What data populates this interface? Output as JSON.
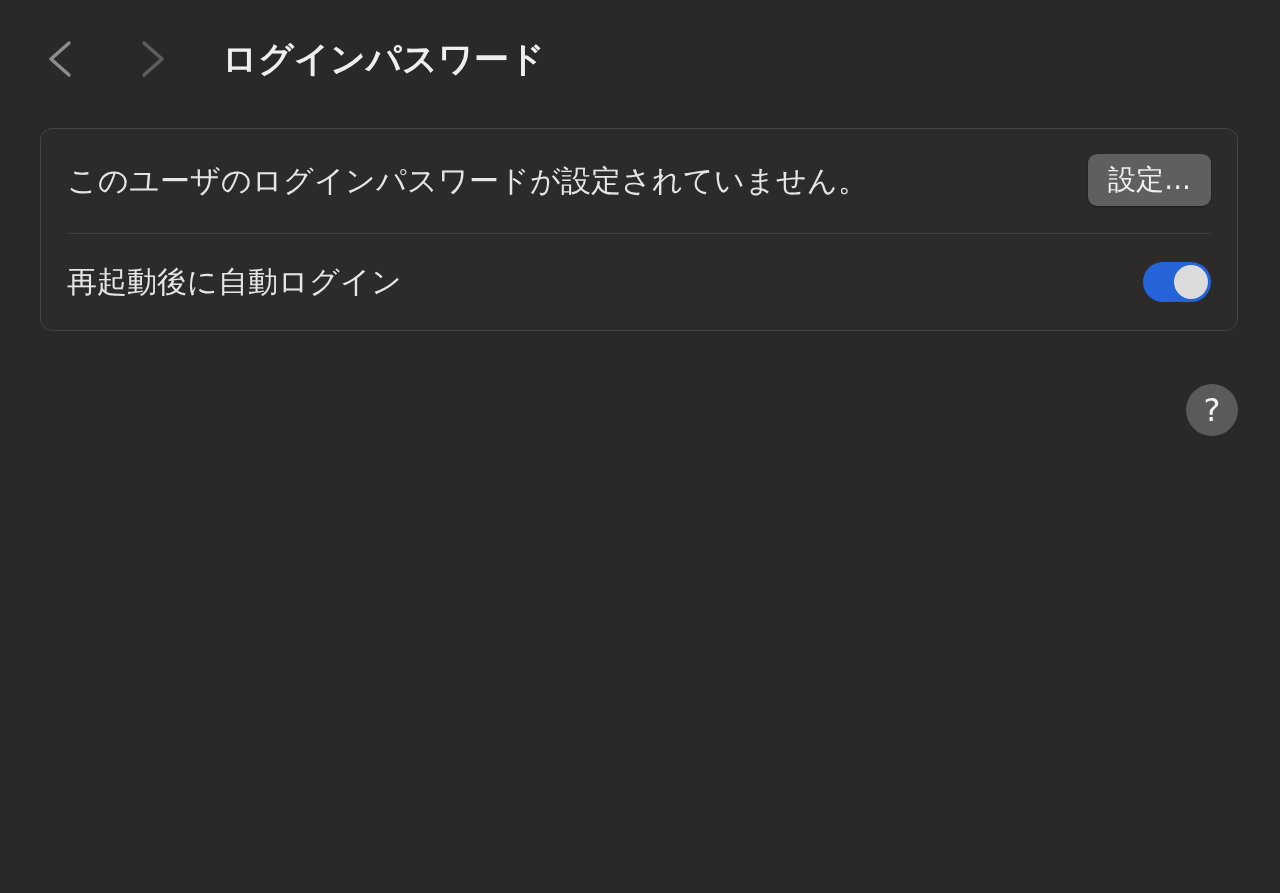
{
  "navigation": {
    "back": {
      "disabled": false
    },
    "forward": {
      "disabled": true
    }
  },
  "title": "ログインパスワード",
  "settings": [
    {
      "kind": "button",
      "label": "このユーザのログインパスワードが設定されていません。",
      "button": "設定..."
    },
    {
      "kind": "toggle",
      "label": "再起動後に自動ログイン",
      "on": true
    }
  ],
  "help_button": {
    "label": "?"
  }
}
